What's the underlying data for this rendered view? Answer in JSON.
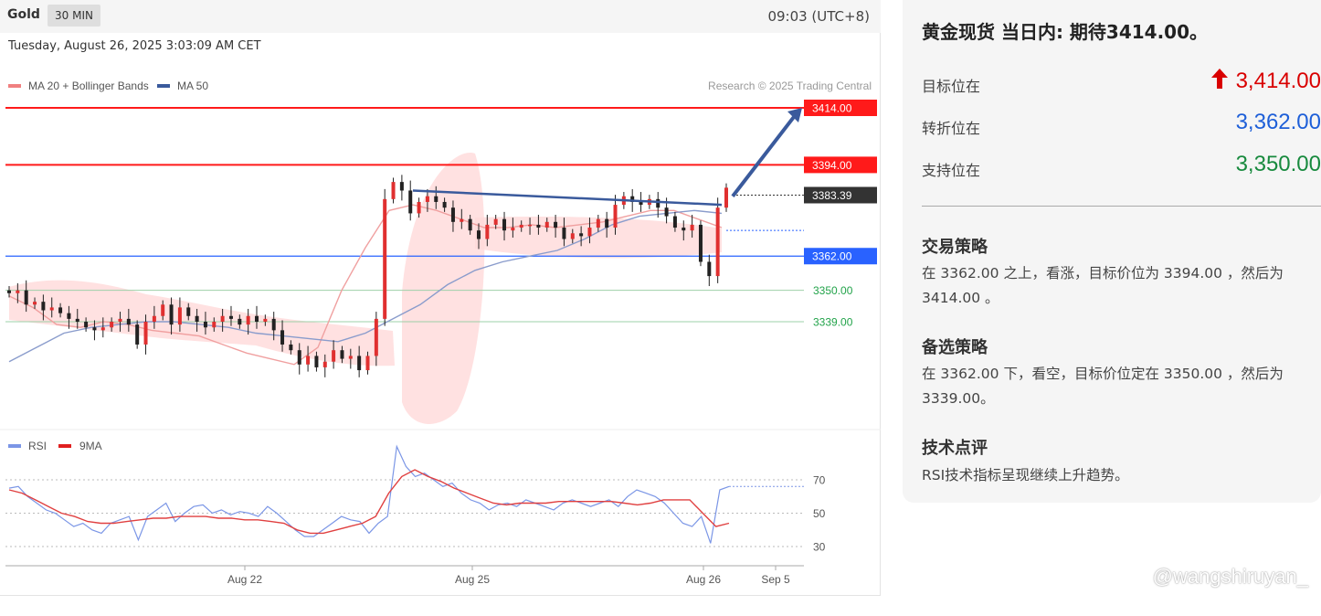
{
  "header": {
    "symbol": "Gold",
    "timeframe": "30 MIN",
    "local_time": "09:03 (UTC+8)",
    "datetime": "Tuesday, August 26, 2025 3:03:09 AM CET"
  },
  "legend": {
    "items": [
      {
        "label": "MA 20 + Bollinger Bands",
        "color": "#f08080"
      },
      {
        "label": "MA 50",
        "color": "#3a5a9c"
      }
    ],
    "rsi_items": [
      {
        "label": "RSI",
        "color": "#7b96e6"
      },
      {
        "label": "9MA",
        "color": "#e02020"
      }
    ],
    "credit": "Research © 2025 Trading Central"
  },
  "chart_data": [
    {
      "type": "candlestick",
      "ylim": [
        3305,
        3420
      ],
      "horizontal_levels": [
        {
          "label": "3414.00",
          "value": 3414.0,
          "color": "#ff1a1a",
          "style": "badge"
        },
        {
          "label": "3394.00",
          "value": 3394.0,
          "color": "#ff1a1a",
          "style": "badge"
        },
        {
          "label": "3383.39",
          "value": 3383.39,
          "color": "#333333",
          "style": "badge-dotted"
        },
        {
          "label": "3362.00",
          "value": 3362.0,
          "color": "#2962ff",
          "style": "badge"
        },
        {
          "label": "3350.00",
          "value": 3350.0,
          "color": "#22a34a",
          "style": "text"
        },
        {
          "label": "3339.00",
          "value": 3339.0,
          "color": "#22a34a",
          "style": "text"
        }
      ],
      "close_path": [
        3349,
        3350,
        3345,
        3346,
        3343,
        3344,
        3342,
        3340,
        3339,
        3337,
        3336,
        3337,
        3339,
        3340,
        3338,
        3331,
        3339,
        3341,
        3345,
        3338,
        3344,
        3341,
        3339,
        3337,
        3339,
        3341,
        3340,
        3338,
        3341,
        3339,
        3340,
        3336,
        3331,
        3329,
        3324,
        3327,
        3323,
        3325,
        3329,
        3326,
        3327,
        3322,
        3327,
        3340,
        3382,
        3388,
        3385,
        3377,
        3381,
        3383,
        3381,
        3379,
        3374,
        3375,
        3371,
        3368,
        3373,
        3375,
        3371,
        3372,
        3373,
        3373,
        3372,
        3374,
        3372,
        3368,
        3370,
        3369,
        3372,
        3375,
        3372,
        3380,
        3383,
        3381,
        3380,
        3382,
        3379,
        3376,
        3372,
        3371,
        3373,
        3360,
        3355,
        3379,
        3386
      ],
      "ma20_path": [
        3348,
        3344,
        3338,
        3337,
        3339,
        3338,
        3336,
        3335,
        3334,
        3331,
        3328,
        3326,
        3324,
        3330,
        3350,
        3365,
        3378,
        3380,
        3378,
        3375,
        3372,
        3372,
        3373,
        3372,
        3373,
        3374,
        3376,
        3378,
        3378,
        3375,
        3372
      ],
      "ma50_path": [
        3325,
        3330,
        3335,
        3337,
        3338,
        3339,
        3339,
        3338,
        3337,
        3335,
        3334,
        3333,
        3332,
        3335,
        3340,
        3345,
        3352,
        3357,
        3360,
        3362,
        3364,
        3368,
        3373,
        3376,
        3377,
        3378,
        3377
      ],
      "projection": {
        "from": 3383,
        "to": 3414
      },
      "trendline": {
        "from": 3385,
        "to": 3380
      }
    },
    {
      "type": "line",
      "series": [
        {
          "name": "RSI",
          "values": [
            65,
            66,
            60,
            56,
            52,
            50,
            46,
            42,
            44,
            40,
            38,
            44,
            46,
            48,
            34,
            48,
            52,
            56,
            45,
            50,
            54,
            55,
            50,
            52,
            49,
            51,
            50,
            48,
            54,
            50,
            45,
            40,
            36,
            36,
            40,
            44,
            48,
            46,
            45,
            38,
            44,
            48,
            90,
            78,
            72,
            74,
            70,
            66,
            68,
            62,
            58,
            56,
            52,
            55,
            56,
            54,
            58,
            56,
            54,
            52,
            56,
            58,
            56,
            54,
            56,
            58,
            54,
            60,
            64,
            62,
            60,
            56,
            50,
            44,
            42,
            48,
            32,
            64,
            66
          ]
        },
        {
          "name": "9MA",
          "values": [
            64,
            62,
            58,
            54,
            50,
            48,
            45,
            44,
            44,
            45,
            46,
            47,
            47,
            48,
            48,
            48,
            47,
            47,
            46,
            46,
            45,
            44,
            40,
            38,
            38,
            40,
            42,
            44,
            48,
            62,
            72,
            76,
            72,
            69,
            65,
            62,
            59,
            56,
            55,
            56,
            56,
            56,
            57,
            57,
            57,
            57,
            57,
            56,
            55,
            56,
            58,
            58,
            58,
            50,
            42,
            44
          ]
        }
      ],
      "ylim": [
        25,
        75
      ],
      "yticks": [
        "70",
        "50",
        "30"
      ]
    }
  ],
  "x_axis": {
    "labels": [
      "Aug 22",
      "Aug 25",
      "Aug 26",
      "Sep 5"
    ]
  },
  "analysis": {
    "title": "黄金现货 当日内: 期待3414.00。",
    "levels": [
      {
        "label": "目标位在",
        "value": "3,414.00",
        "color": "#d90000",
        "icon": "arrow-up-icon"
      },
      {
        "label": "转折位在",
        "value": "3,362.00",
        "color": "#1e5fd8"
      },
      {
        "label": "支持位在",
        "value": "3,350.00",
        "color": "#188a3e"
      }
    ],
    "sections": [
      {
        "title": "交易策略",
        "body": "在 3362.00 之上，看涨，目标价位为 3394.00 ，然后为 3414.00 。"
      },
      {
        "title": "备选策略",
        "body": "在 3362.00 下，看空，目标价位定在 3350.00 ，然后为 3339.00。"
      },
      {
        "title": "技术点评",
        "body": "RSI技术指标呈现继续上升趋势。"
      }
    ]
  },
  "watermark": "@wangshiruyan_"
}
